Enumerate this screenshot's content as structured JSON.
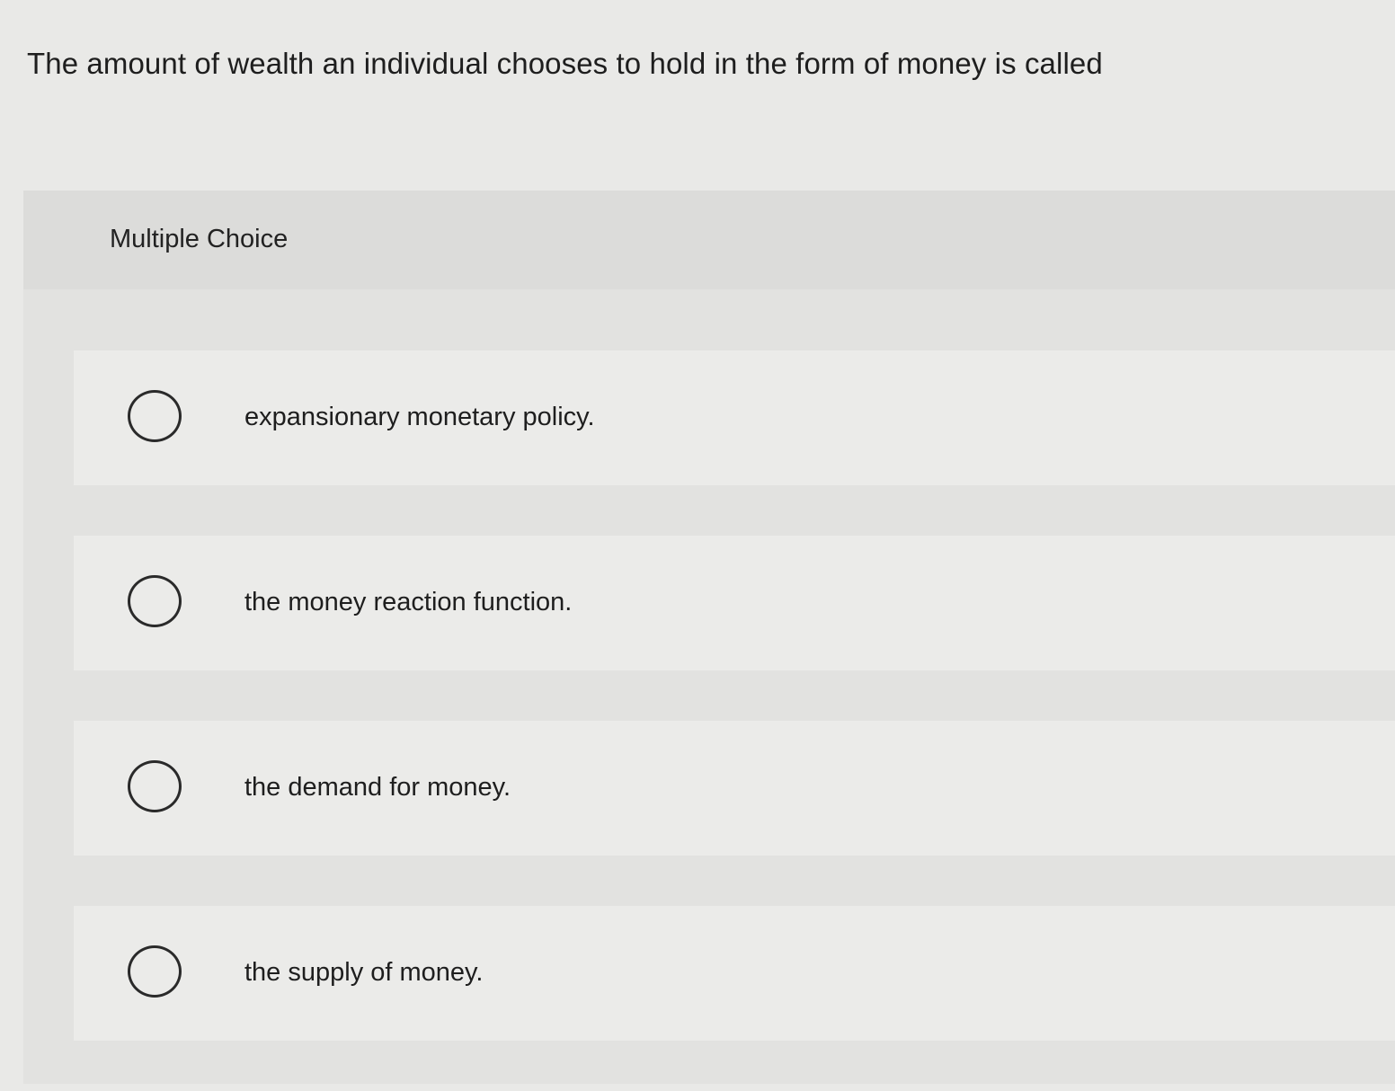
{
  "question": {
    "text": "The amount of wealth an individual chooses to hold in the form of money is called"
  },
  "panel": {
    "title": "Multiple Choice"
  },
  "options": [
    {
      "label": "expansionary monetary policy."
    },
    {
      "label": "the money reaction function."
    },
    {
      "label": "the demand for money."
    },
    {
      "label": "the supply of money."
    }
  ]
}
